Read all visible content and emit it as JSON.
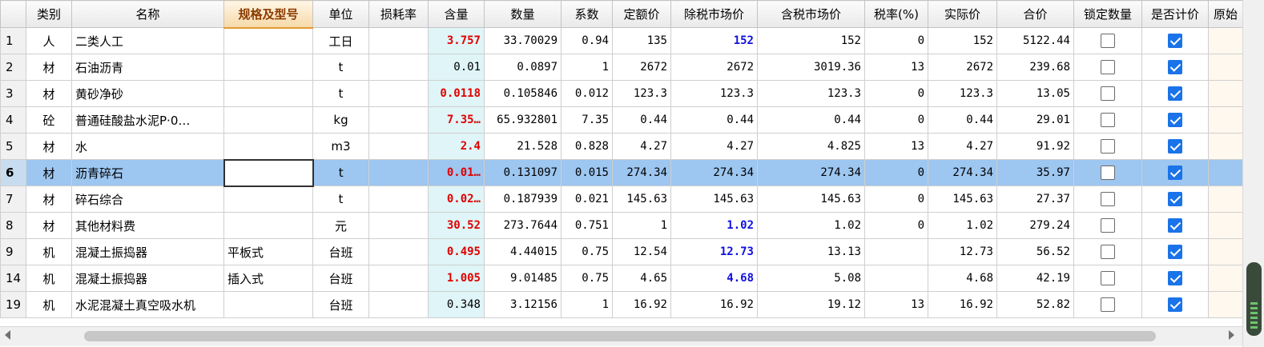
{
  "headers": {
    "rownum": "",
    "type": "类别",
    "name": "名称",
    "spec": "规格及型号",
    "unit": "单位",
    "loss": "损耗率",
    "content": "含量",
    "quantity": "数量",
    "coef": "系数",
    "quota_price": "定额价",
    "excl_tax_price": "除税市场价",
    "incl_tax_price": "含税市场价",
    "tax_rate": "税率(%)",
    "actual_price": "实际价",
    "total": "合价",
    "lock_qty": "锁定数量",
    "priced": "是否计价",
    "original": "原始"
  },
  "rows": [
    {
      "num": "1",
      "type": "人",
      "name": "二类人工",
      "spec": "",
      "unit": "工日",
      "loss": "",
      "content": "3.757",
      "content_red": true,
      "quantity": "33.70029",
      "coef": "0.94",
      "quota_price": "135",
      "excl_tax_price": "152",
      "excl_blue": true,
      "incl_tax_price": "152",
      "tax_rate": "0",
      "actual_price": "152",
      "total": "5122.44",
      "lock": false,
      "priced": true
    },
    {
      "num": "2",
      "type": "材",
      "name": "石油沥青",
      "spec": "",
      "unit": "t",
      "loss": "",
      "content": "0.01",
      "content_red": false,
      "quantity": "0.0897",
      "coef": "1",
      "quota_price": "2672",
      "excl_tax_price": "2672",
      "excl_blue": false,
      "incl_tax_price": "3019.36",
      "tax_rate": "13",
      "actual_price": "2672",
      "total": "239.68",
      "lock": false,
      "priced": true
    },
    {
      "num": "3",
      "type": "材",
      "name": "黄砂净砂",
      "spec": "",
      "unit": "t",
      "loss": "",
      "content": "0.0118",
      "content_red": true,
      "quantity": "0.105846",
      "coef": "0.012",
      "quota_price": "123.3",
      "excl_tax_price": "123.3",
      "excl_blue": false,
      "incl_tax_price": "123.3",
      "tax_rate": "0",
      "actual_price": "123.3",
      "total": "13.05",
      "lock": false,
      "priced": true
    },
    {
      "num": "4",
      "type": "砼",
      "name": "普通硅酸盐水泥P·0…",
      "spec": "",
      "unit": "kg",
      "loss": "",
      "content": "7.35…",
      "content_red": true,
      "quantity": "65.932801",
      "coef": "7.35",
      "quota_price": "0.44",
      "excl_tax_price": "0.44",
      "excl_blue": false,
      "incl_tax_price": "0.44",
      "tax_rate": "0",
      "actual_price": "0.44",
      "total": "29.01",
      "lock": false,
      "priced": true
    },
    {
      "num": "5",
      "type": "材",
      "name": "水",
      "spec": "",
      "unit": "m3",
      "loss": "",
      "content": "2.4",
      "content_red": true,
      "quantity": "21.528",
      "coef": "0.828",
      "quota_price": "4.27",
      "excl_tax_price": "4.27",
      "excl_blue": false,
      "incl_tax_price": "4.825",
      "tax_rate": "13",
      "actual_price": "4.27",
      "total": "91.92",
      "lock": false,
      "priced": true
    },
    {
      "num": "6",
      "type": "材",
      "name": "沥青碎石",
      "spec": "",
      "unit": "t",
      "loss": "",
      "content": "0.01…",
      "content_red": true,
      "quantity": "0.131097",
      "coef": "0.015",
      "quota_price": "274.34",
      "excl_tax_price": "274.34",
      "excl_blue": false,
      "incl_tax_price": "274.34",
      "tax_rate": "0",
      "actual_price": "274.34",
      "total": "35.97",
      "lock": false,
      "priced": true,
      "selected": true
    },
    {
      "num": "7",
      "type": "材",
      "name": "碎石综合",
      "spec": "",
      "unit": "t",
      "loss": "",
      "content": "0.02…",
      "content_red": true,
      "quantity": "0.187939",
      "coef": "0.021",
      "quota_price": "145.63",
      "excl_tax_price": "145.63",
      "excl_blue": false,
      "incl_tax_price": "145.63",
      "tax_rate": "0",
      "actual_price": "145.63",
      "total": "27.37",
      "lock": false,
      "priced": true
    },
    {
      "num": "8",
      "type": "材",
      "name": "其他材料费",
      "spec": "",
      "unit": "元",
      "loss": "",
      "content": "30.52",
      "content_red": true,
      "quantity": "273.7644",
      "coef": "0.751",
      "quota_price": "1",
      "excl_tax_price": "1.02",
      "excl_blue": true,
      "incl_tax_price": "1.02",
      "tax_rate": "0",
      "actual_price": "1.02",
      "total": "279.24",
      "lock": false,
      "priced": true
    },
    {
      "num": "9",
      "type": "机",
      "name": "混凝土振捣器",
      "spec": "平板式",
      "unit": "台班",
      "loss": "",
      "content": "0.495",
      "content_red": true,
      "quantity": "4.44015",
      "coef": "0.75",
      "quota_price": "12.54",
      "excl_tax_price": "12.73",
      "excl_blue": true,
      "incl_tax_price": "13.13",
      "tax_rate": "",
      "actual_price": "12.73",
      "total": "56.52",
      "lock": false,
      "priced": true
    },
    {
      "num": "14",
      "type": "机",
      "name": "混凝土振捣器",
      "spec": "插入式",
      "unit": "台班",
      "loss": "",
      "content": "1.005",
      "content_red": true,
      "quantity": "9.01485",
      "coef": "0.75",
      "quota_price": "4.65",
      "excl_tax_price": "4.68",
      "excl_blue": true,
      "incl_tax_price": "5.08",
      "tax_rate": "",
      "actual_price": "4.68",
      "total": "42.19",
      "lock": false,
      "priced": true
    },
    {
      "num": "19",
      "type": "机",
      "name": "水泥混凝土真空吸水机",
      "spec": "",
      "unit": "台班",
      "loss": "",
      "content": "0.348",
      "content_red": false,
      "quantity": "3.12156",
      "coef": "1",
      "quota_price": "16.92",
      "excl_tax_price": "16.92",
      "excl_blue": false,
      "incl_tax_price": "19.12",
      "tax_rate": "13",
      "actual_price": "16.92",
      "total": "52.82",
      "lock": false,
      "priced": true
    }
  ]
}
